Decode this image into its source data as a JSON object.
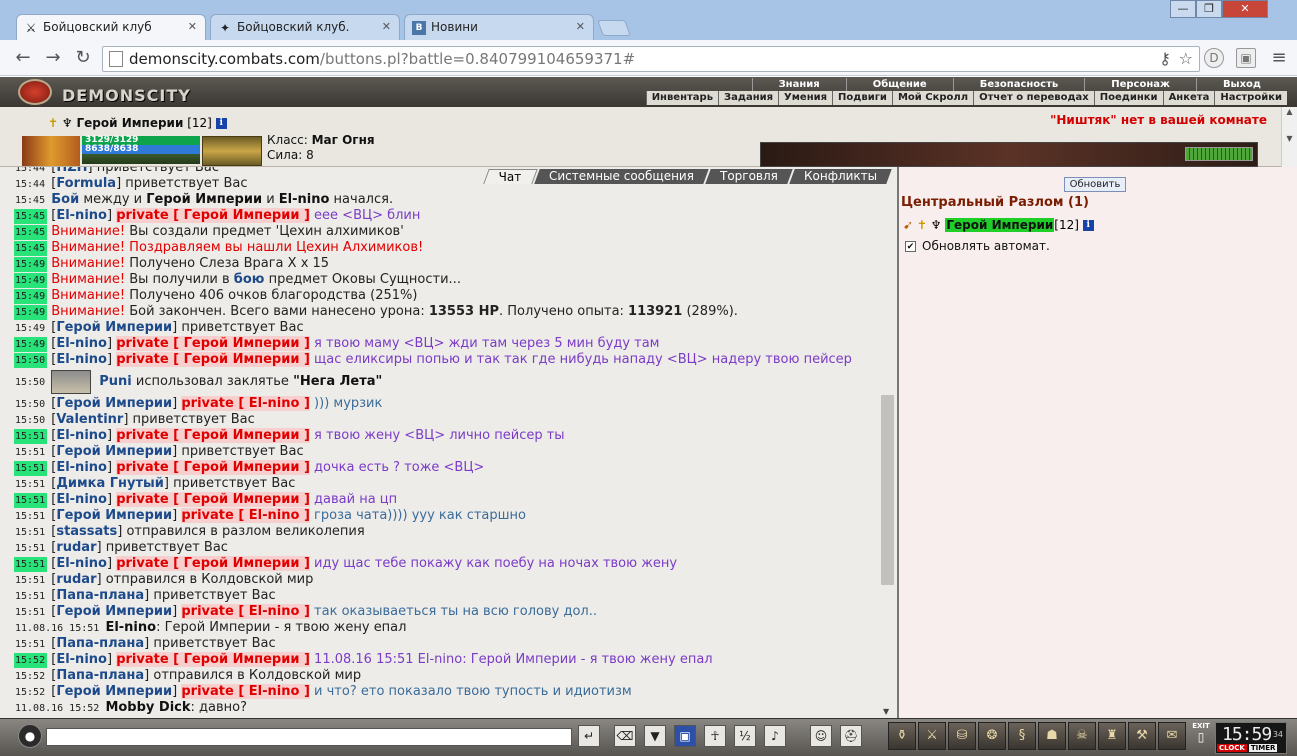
{
  "browser": {
    "tabs": [
      {
        "title": "Бойцовский клуб",
        "icon": "swords-icon",
        "active": true
      },
      {
        "title": "Бойцовский клуб.",
        "icon": "shield-icon",
        "active": false
      },
      {
        "title": "Новини",
        "icon": "vk-icon",
        "active": false
      }
    ],
    "url_host": "demonscity.combats.com",
    "url_rest": "/buttons.pl?battle=0.840799104659371#"
  },
  "game": {
    "logo_text": "DEMONSCITY",
    "top_menu": [
      "Знания",
      "Общение",
      "Безопасность",
      "Персонаж",
      "Выход"
    ],
    "sub_menu": [
      "Инвентарь",
      "Задания",
      "Умения",
      "Подвиги",
      "Мой Скролл",
      "Отчет о переводах",
      "Поединки",
      "Анкета",
      "Настройки"
    ],
    "character": {
      "name": "Герой Империи",
      "level": "[12]",
      "hp": "3129/3129",
      "mana": "8638/8638",
      "class_label": "Класс:",
      "class_value": "Маг Огня",
      "strength_label": "Сила:",
      "strength_value": "8"
    },
    "warning": "\"Ништяк\" нет в вашей комнате"
  },
  "chat": {
    "tabs": [
      "Чат",
      "Системные сообщения",
      "Торговля",
      "Конфликты"
    ]
  },
  "room": {
    "refresh_label": "Обновить",
    "title": "Центральный Разлом (1)",
    "user_name": "Герой Империи",
    "user_level": "[12]",
    "auto_refresh_label": "Обновлять автомат."
  },
  "bottom": {
    "clock_time": "15:59",
    "clock_seconds": "34",
    "clock_label": "CLOCK",
    "timer_label": "TIMER",
    "exit_label": "EXIT"
  }
}
